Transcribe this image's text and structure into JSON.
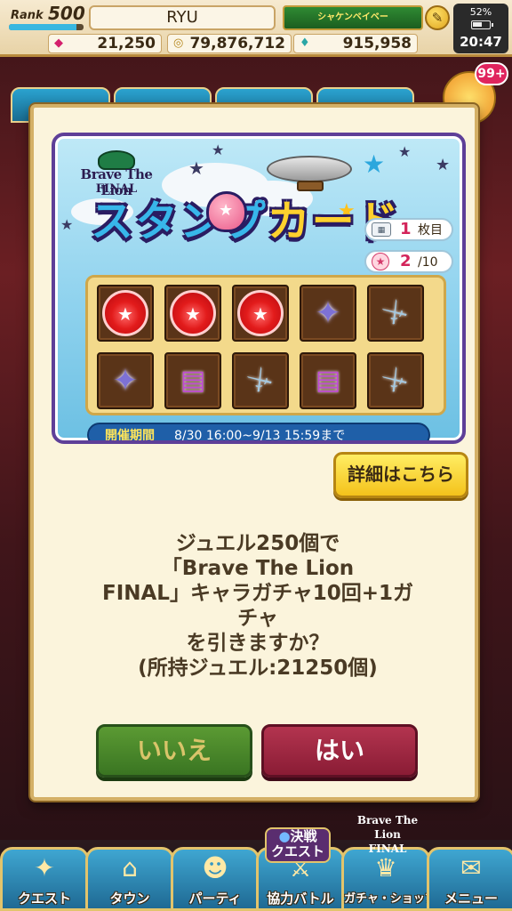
{
  "header": {
    "rank_label": "Rank",
    "rank_value": "500",
    "rank_progress": 0.9,
    "player_name": "RYU",
    "title_badge": "シャケンベイベー",
    "battery_percent": "52%",
    "clock": "20:47",
    "currencies": {
      "jewels": "21,250",
      "coins": "79,876,712",
      "other": "915,958"
    },
    "icons": {
      "jewel": "diamond-icon",
      "coin": "coin-icon",
      "drop": "drop-icon",
      "edit": "pencil-icon"
    }
  },
  "background": {
    "gift_badge": "99+"
  },
  "stamp_card": {
    "brand_line1": "Brave The Lion",
    "brand_line2": "FINAL",
    "title_part1": "スタン",
    "title_part2": "プ",
    "title_part3": "カード",
    "sheet_number": "1",
    "sheet_unit": "枚目",
    "stamp_count": "2",
    "stamp_total": "/10",
    "slots": [
      {
        "type": "stamped"
      },
      {
        "type": "stamped"
      },
      {
        "type": "stamped"
      },
      {
        "type": "star"
      },
      {
        "type": "sword"
      },
      {
        "type": "star"
      },
      {
        "type": "book"
      },
      {
        "type": "sword"
      },
      {
        "type": "book"
      },
      {
        "type": "sword"
      }
    ],
    "period_label": "開催期間",
    "period_value": "8/30  16:00~9/13  15:59まで"
  },
  "dialog": {
    "details_button": "詳細はこちら",
    "message_lines": [
      "ジュエル250個で",
      "「Brave The Lion",
      "FINAL」キャラガチャ10回+1ガ",
      "チャ",
      "を引きますか？",
      "(所持ジュエル:21250個)"
    ],
    "no_button": "いいえ",
    "yes_button": "はい"
  },
  "bottom_nav": {
    "items": [
      {
        "label": "クエスト",
        "icon": "map-icon"
      },
      {
        "label": "タウン",
        "icon": "pot-icon"
      },
      {
        "label": "パーティ",
        "icon": "party-icon"
      },
      {
        "label": "協力バトル",
        "icon": "battle-icon"
      },
      {
        "label": "ガチャ・ショップ",
        "icon": "gacha-icon"
      },
      {
        "label": "メニュー",
        "icon": "scroll-icon"
      }
    ],
    "battle_badge_line1": "決戦",
    "battle_badge_line2": "クエスト",
    "gacha_badge_line1": "Brave The Lion",
    "gacha_badge_line2": "FINAL"
  }
}
